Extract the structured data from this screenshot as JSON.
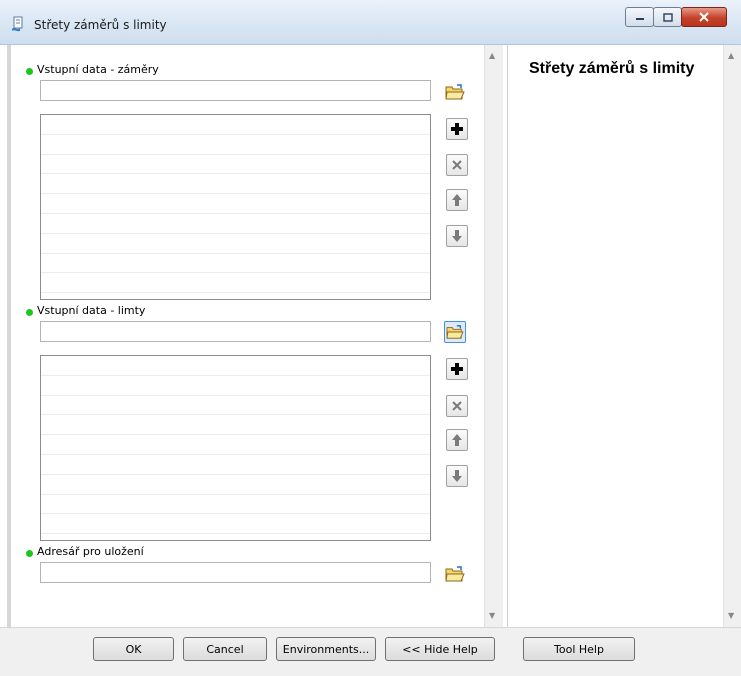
{
  "window": {
    "title": "Střety záměrů s limity",
    "controls": [
      "minimize",
      "maximize",
      "close"
    ]
  },
  "form": {
    "param1": {
      "label": "Vstupní data - záměry",
      "value": "",
      "list_rows": 9
    },
    "param2": {
      "label": "Vstupní data - limty",
      "value": "",
      "list_rows": 9
    },
    "param3": {
      "label": "Adresář pro uložení",
      "value": ""
    },
    "icons": {
      "browse": "folder-open-icon",
      "add": "plus-icon",
      "remove": "x-icon",
      "up": "arrow-up-icon",
      "down": "arrow-down-icon"
    }
  },
  "help": {
    "title": "Střety záměrů s limity"
  },
  "buttons": {
    "ok": "OK",
    "cancel": "Cancel",
    "environments": "Environments...",
    "hide_help": "<< Hide Help",
    "tool_help": "Tool Help"
  },
  "colors": {
    "required_dot": "#19c819",
    "window_bg": "#f0f0f0",
    "close_button": "#c5422a"
  }
}
